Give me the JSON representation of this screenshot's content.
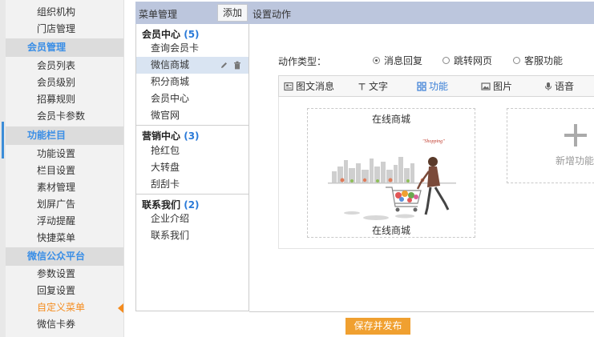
{
  "sidebar": {
    "groups": [
      {
        "title": "",
        "items": [
          "组织机构",
          "门店管理"
        ]
      },
      {
        "title": "会员管理",
        "items": [
          "会员列表",
          "会员级别",
          "招募规则",
          "会员卡参数"
        ]
      },
      {
        "title": "功能栏目",
        "items": [
          "功能设置",
          "栏目设置",
          "素材管理",
          "划屏广告",
          "浮动提醒",
          "快捷菜单"
        ]
      },
      {
        "title": "微信公众平台",
        "items": [
          "参数设置",
          "回复设置",
          "自定义菜单",
          "微信卡券"
        ]
      }
    ],
    "active_item": "自定义菜单",
    "colors": {
      "section_text": "#3a8ee6",
      "active_text": "#f58c1e"
    }
  },
  "header": {
    "menu_title": "菜单管理",
    "add_label": "添加",
    "settings_title": "设置动作"
  },
  "menu": {
    "groups": [
      {
        "name": "会员中心",
        "count": "(5)",
        "items": [
          "查询会员卡",
          "微信商城",
          "积分商城",
          "会员中心",
          "微官网"
        ]
      },
      {
        "name": "营销中心",
        "count": "(3)",
        "items": [
          "抢红包",
          "大转盘",
          "刮刮卡"
        ]
      },
      {
        "name": "联系我们",
        "count": "(2)",
        "items": [
          "企业介绍",
          "联系我们"
        ]
      }
    ],
    "selected_item": "微信商城"
  },
  "action": {
    "type_label": "动作类型：",
    "options": [
      "消息回复",
      "跳转网页",
      "客服功能"
    ],
    "selected": "消息回复"
  },
  "tabs": {
    "items": [
      "图文消息",
      "文字",
      "功能",
      "图片",
      "语音"
    ],
    "active": "功能"
  },
  "card": {
    "top_title": "在线商城",
    "bottom_title": "在线商城",
    "image_text": "\"Shopping\""
  },
  "new_card": {
    "label": "新增功能"
  },
  "save_label": "保存并发布"
}
